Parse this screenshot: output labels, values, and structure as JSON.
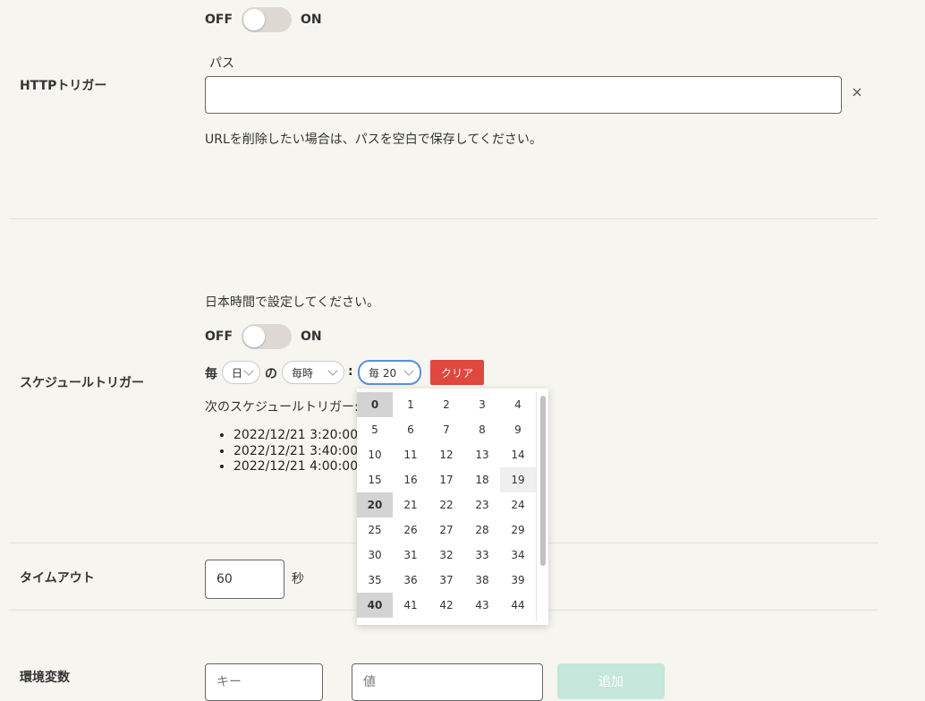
{
  "http_trigger": {
    "label": "HTTPトリガー",
    "toggle_off": "OFF",
    "toggle_on": "ON",
    "path_label": "パス",
    "path_value": "",
    "clear_icon": "close-icon",
    "note": "URLを削除したい場合は、パスを空白で保存してください。"
  },
  "schedule_trigger": {
    "label": "スケジュールトリガー",
    "instruction": "日本時間で設定してください。",
    "toggle_off": "OFF",
    "toggle_on": "ON",
    "every_prefix": "毎",
    "unit_value": "日",
    "of_text": "の",
    "hour_value": "毎時",
    "colon": ":",
    "minute_value": "毎 20",
    "clear_label": "クリア",
    "next_label": "次のスケジュールトリガー:",
    "next_runs": [
      "2022/12/21 3:20:00",
      "2022/12/21 3:40:00",
      "2022/12/21 4:00:00"
    ],
    "minute_options": [
      "0",
      "1",
      "2",
      "3",
      "4",
      "5",
      "6",
      "7",
      "8",
      "9",
      "10",
      "11",
      "12",
      "13",
      "14",
      "15",
      "16",
      "17",
      "18",
      "19",
      "20",
      "21",
      "22",
      "23",
      "24",
      "25",
      "26",
      "27",
      "28",
      "29",
      "30",
      "31",
      "32",
      "33",
      "34",
      "35",
      "36",
      "37",
      "38",
      "39",
      "40",
      "41",
      "42",
      "43",
      "44"
    ],
    "selected_minutes": [
      "0",
      "20",
      "40"
    ],
    "hovered_minute": "19"
  },
  "timeout": {
    "label": "タイムアウト",
    "value": "60",
    "unit": "秒"
  },
  "env_vars": {
    "label": "環境変数",
    "key_placeholder": "キー",
    "value_placeholder": "値",
    "add_label": "追加"
  },
  "colors": {
    "background": "#f6f5f0",
    "clear_button": "#e0473f",
    "add_button_disabled": "#c5e6da",
    "focus_border": "#5b8fd6"
  }
}
